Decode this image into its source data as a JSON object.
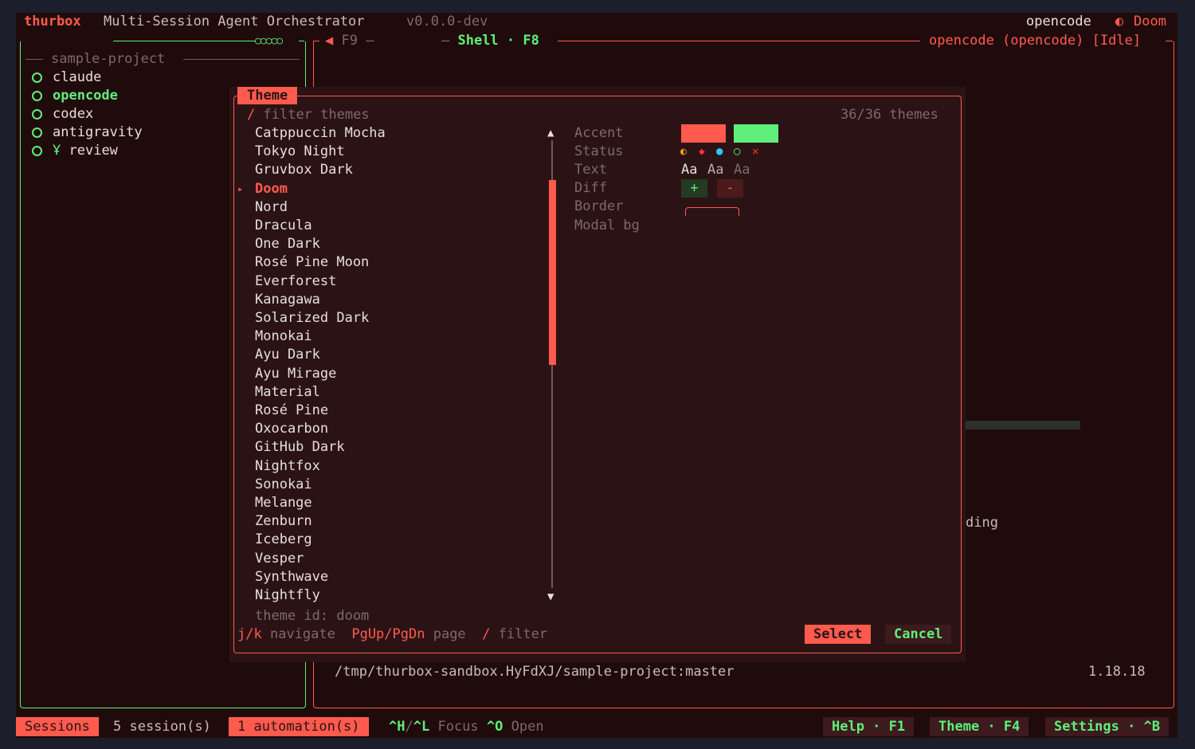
{
  "header": {
    "app_name": "thurbox",
    "subtitle": "Multi-Session Agent Orchestrator",
    "version": "v0.0.0-dev",
    "current_session": "opencode",
    "theme_icon": "◐",
    "current_theme": "Doom"
  },
  "panel_tabs": {
    "f9_label": "◀ F9 —",
    "shell_label": "Shell · F8",
    "session_status": "opencode (opencode) [Idle]"
  },
  "sidebar": {
    "project": "sample-project",
    "sessions": [
      {
        "label": "claude",
        "active": false,
        "icon": ""
      },
      {
        "label": "opencode",
        "active": true,
        "icon": ""
      },
      {
        "label": "codex",
        "active": false,
        "icon": ""
      },
      {
        "label": "antigravity",
        "active": false,
        "icon": ""
      },
      {
        "label": "review",
        "active": false,
        "icon": "Ұ"
      }
    ]
  },
  "shell": {
    "partial_text": "ding",
    "path": "/tmp/thurbox-sandbox.HyFdXJ/sample-project:master",
    "version": "1.18.18"
  },
  "theme_modal": {
    "title": "Theme",
    "filter_prefix": "/",
    "filter_placeholder": "filter themes",
    "count": "36/36 themes",
    "selected_marker": "▸",
    "themes": [
      "Catppuccin Mocha",
      "Tokyo Night",
      "Gruvbox Dark",
      "Doom",
      "Nord",
      "Dracula",
      "One Dark",
      "Rosé Pine Moon",
      "Everforest",
      "Kanagawa",
      "Solarized Dark",
      "Monokai",
      "Ayu Dark",
      "Ayu Mirage",
      "Material",
      "Rosé Pine",
      "Oxocarbon",
      "GitHub Dark",
      "Nightfox",
      "Sonokai",
      "Melange",
      "Zenburn",
      "Iceberg",
      "Vesper",
      "Synthwave",
      "Nightfly"
    ],
    "selected_index": 3,
    "scroll_up": "▲",
    "scroll_down": "▼",
    "theme_id": "theme id: doom",
    "preview": {
      "accent_label": "Accent",
      "status_label": "Status",
      "text_label": "Text",
      "diff_label": "Diff",
      "border_label": "Border",
      "modal_bg_label": "Modal bg",
      "text_sample": "Aa",
      "diff_add": "+",
      "diff_remove": "-",
      "status_icons": [
        "◐",
        "◆",
        "●",
        "○",
        "✕"
      ]
    },
    "hints": {
      "nav_key": "j/k",
      "nav_label": "navigate",
      "page_key": "PgUp/PgDn",
      "page_label": "page",
      "filter_key": "/",
      "filter_label": "filter"
    },
    "select_label": "Select",
    "cancel_label": "Cancel"
  },
  "status_bar": {
    "sessions_label": "Sessions",
    "session_count": "5 session(s)",
    "automation": "1 automation(s)",
    "focus_keys_a": "^H",
    "focus_sep": "/",
    "focus_keys_b": "^L",
    "focus_label": "Focus",
    "open_key": "^O",
    "open_label": "Open",
    "help": "Help · F1",
    "theme": "Theme · F4",
    "settings": "Settings · ^B"
  },
  "colors": {
    "accent": "#ff5a4e",
    "secondary": "#5ef07a",
    "background": "#200b0c",
    "modal_bg": "#2b1315",
    "status_orange": "#f0a020",
    "status_red": "#ff3030",
    "status_cyan": "#28c8f0"
  }
}
